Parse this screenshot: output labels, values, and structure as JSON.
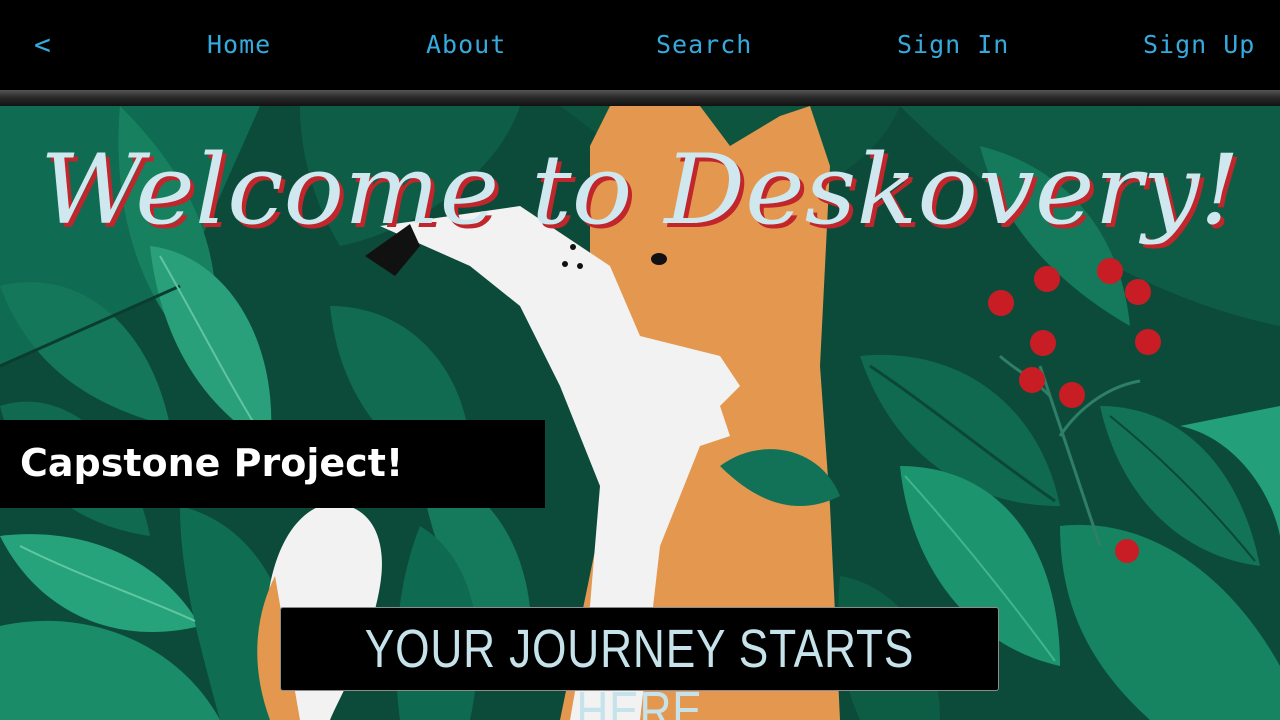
{
  "nav": {
    "back": "<",
    "items": [
      "Home",
      "About",
      "Search",
      "Sign In",
      "Sign Up"
    ]
  },
  "hero": {
    "title": "Welcome to Deskovery!",
    "badge": "Capstone Project!",
    "tagline": "YOUR JOURNEY STARTS HERE"
  },
  "colors": {
    "nav_link": "#36a9de",
    "title_fill": "#cfe7ef",
    "title_shadow": "#c0262b",
    "jungle": "#0c4b3a",
    "fox": "#e4984f"
  }
}
